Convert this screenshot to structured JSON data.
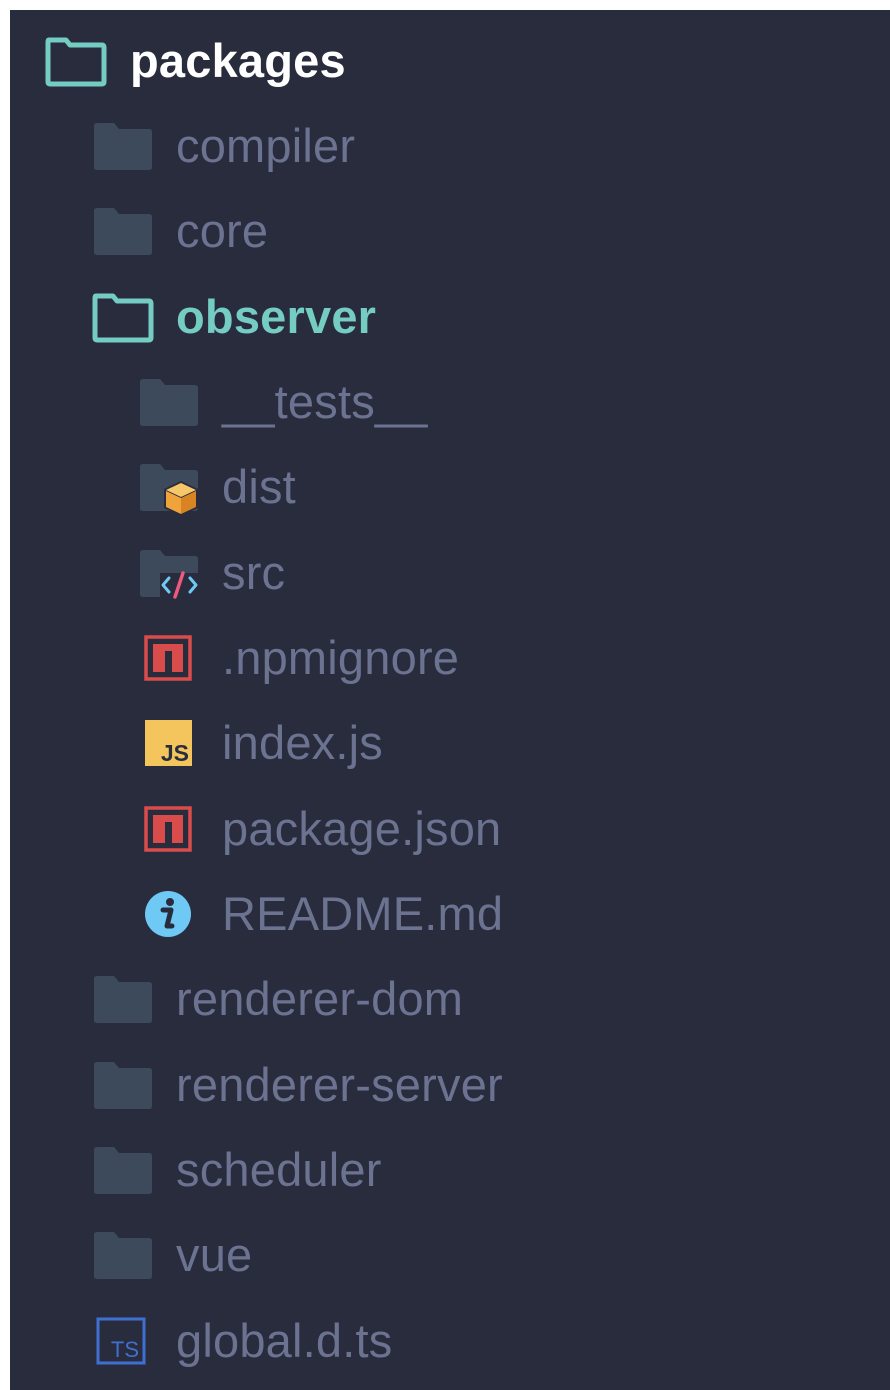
{
  "tree": {
    "root": {
      "label": "packages",
      "icon": "folder-open-icon"
    },
    "items": [
      {
        "label": "compiler",
        "icon": "folder-icon"
      },
      {
        "label": "core",
        "icon": "folder-icon"
      },
      {
        "label": "observer",
        "icon": "folder-open-icon"
      },
      {
        "label": "__tests__",
        "icon": "folder-icon"
      },
      {
        "label": "dist",
        "icon": "folder-dist-icon"
      },
      {
        "label": "src",
        "icon": "folder-src-icon"
      },
      {
        "label": ".npmignore",
        "icon": "npm-icon"
      },
      {
        "label": "index.js",
        "icon": "js-icon"
      },
      {
        "label": "package.json",
        "icon": "npm-icon"
      },
      {
        "label": "README.md",
        "icon": "info-icon"
      },
      {
        "label": "renderer-dom",
        "icon": "folder-icon"
      },
      {
        "label": "renderer-server",
        "icon": "folder-icon"
      },
      {
        "label": "scheduler",
        "icon": "folder-icon"
      },
      {
        "label": "vue",
        "icon": "folder-icon"
      },
      {
        "label": "global.d.ts",
        "icon": "typescript-icon"
      }
    ]
  },
  "colors": {
    "background": "#282c3d",
    "folder": "#3d4a5c",
    "accent_open": "#74ccc2",
    "label_default": "#6c7391",
    "root_label": "#ffffff",
    "npm_red": "#d94c4c",
    "js_yellow": "#f3c55c",
    "info_blue": "#6ec9f4",
    "typescript_blue": "#3f6fd1",
    "dist_orange": "#f1a33b"
  }
}
